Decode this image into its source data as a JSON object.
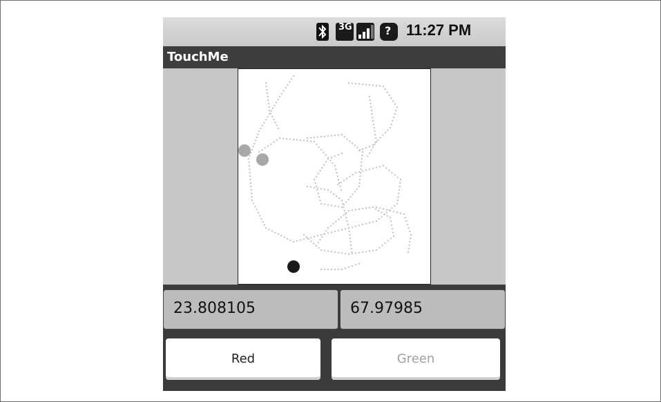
{
  "status_bar": {
    "network_label": "3G",
    "help_label": "?",
    "time": "11:27 PM",
    "icons": [
      "bluetooth-icon",
      "3g-icon",
      "signal-icon",
      "help-icon"
    ]
  },
  "app": {
    "title": "TouchMe"
  },
  "fields": {
    "x_value": "23.808105",
    "y_value": "67.97985"
  },
  "buttons": {
    "red_label": "Red",
    "green_label": "Green"
  },
  "colors": {
    "dot_light": "#a8a8a8",
    "dot_dark": "#1a1a1a",
    "trail": "#bdbdbd"
  }
}
